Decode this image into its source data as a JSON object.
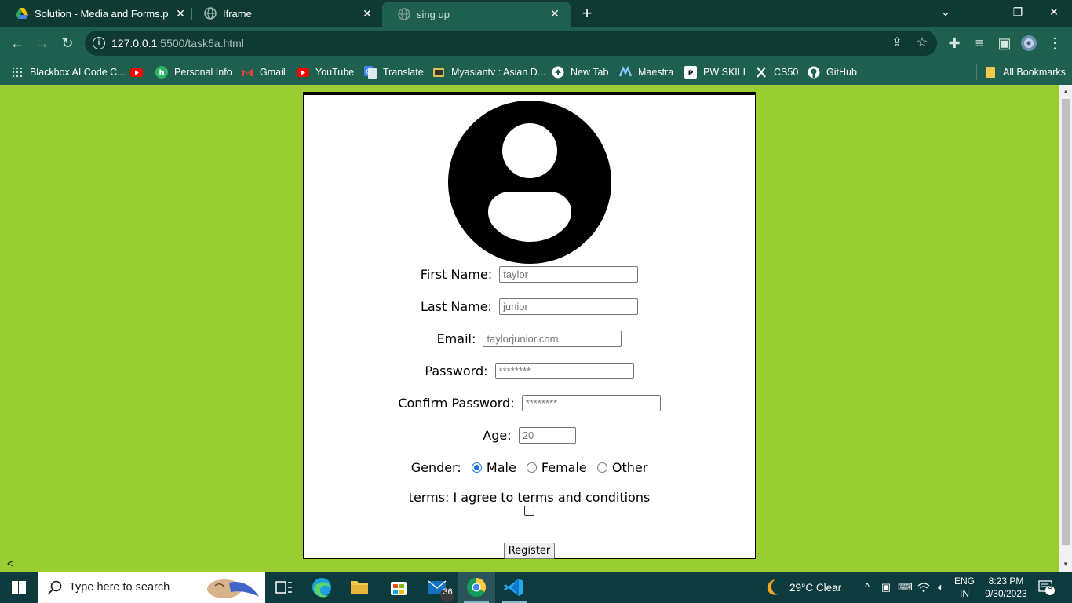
{
  "browser": {
    "tabs": [
      {
        "title": "Solution - Media and Forms.pdf",
        "active": false
      },
      {
        "title": "Iframe",
        "active": false
      },
      {
        "title": "sing up",
        "active": true
      }
    ],
    "url_host": "127.0.0.1",
    "url_path": ":5500/task5a.html"
  },
  "bookmarks": [
    {
      "label": "Blackbox AI Code C...",
      "icon": "blackbox-icon"
    },
    {
      "label": "",
      "icon": "youtube-icon"
    },
    {
      "label": "Personal Info",
      "icon": "personal-info-icon"
    },
    {
      "label": "Gmail",
      "icon": "gmail-icon"
    },
    {
      "label": "YouTube",
      "icon": "youtube-icon"
    },
    {
      "label": "Translate",
      "icon": "translate-icon"
    },
    {
      "label": "Myasiantv : Asian D...",
      "icon": "myasiantv-icon"
    },
    {
      "label": "New Tab",
      "icon": "new-tab-icon"
    },
    {
      "label": "Maestra",
      "icon": "maestra-icon"
    },
    {
      "label": "PW SKILL",
      "icon": "pw-skill-icon"
    },
    {
      "label": "CS50",
      "icon": "cs50-icon"
    },
    {
      "label": "GitHub",
      "icon": "github-icon"
    }
  ],
  "all_bookmarks_label": "All Bookmarks",
  "form": {
    "first_name": {
      "label": "First Name:",
      "placeholder": "taylor"
    },
    "last_name": {
      "label": "Last Name:",
      "placeholder": "junior"
    },
    "email": {
      "label": "Email:",
      "placeholder": "taylorjunior.com"
    },
    "password": {
      "label": "Password:",
      "placeholder": "********"
    },
    "confirm_password": {
      "label": "Confirm Password:",
      "placeholder": "********"
    },
    "age": {
      "label": "Age:",
      "placeholder": "20"
    },
    "gender": {
      "label": "Gender:",
      "options": [
        "Male",
        "Female",
        "Other"
      ],
      "selected": "Male"
    },
    "terms_label": "terms: I agree to terms and conditions",
    "register_label": "Register"
  },
  "page_chevron": "<",
  "taskbar": {
    "search_placeholder": "Type here to search",
    "mail_badge": "36",
    "weather": "29°C  Clear",
    "lang_top": "ENG",
    "lang_bottom": "IN",
    "time": "8:23 PM",
    "date": "9/30/2023",
    "notifications": "3"
  },
  "colors": {
    "page_background": "#9acd32",
    "browser_frame": "#1f5f4f",
    "taskbar": "#0c3a3d",
    "radio_accent": "#1a73e8"
  }
}
